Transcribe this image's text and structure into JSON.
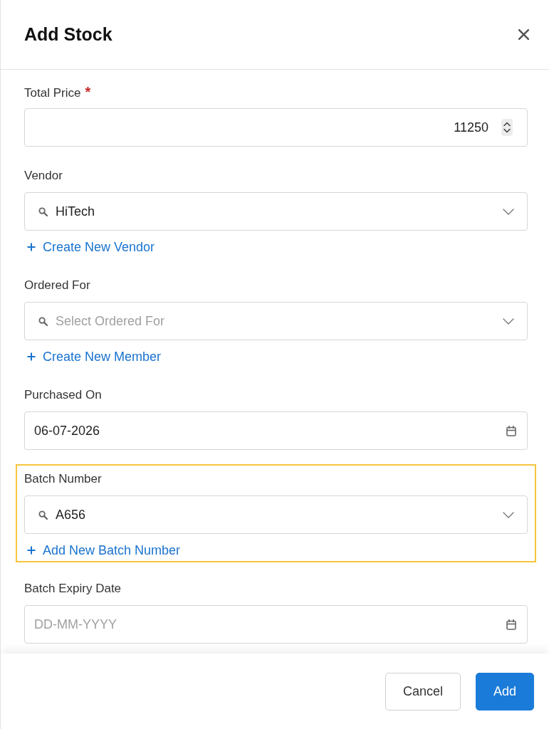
{
  "dialog": {
    "title": "Add Stock"
  },
  "fields": [
    {
      "kind": "number",
      "label": "Total Price",
      "required_mark": "*",
      "value": "11250",
      "highlighted": false
    },
    {
      "kind": "search-select",
      "label": "Vendor",
      "value": "HiTech",
      "link": "Create New Vendor",
      "highlighted": false
    },
    {
      "kind": "search-select",
      "label": "Ordered For",
      "placeholder": "Select Ordered For",
      "link": "Create New Member",
      "highlighted": false
    },
    {
      "kind": "date",
      "label": "Purchased On",
      "value": "06-07-2026",
      "highlighted": false
    },
    {
      "kind": "search-select",
      "label": "Batch Number",
      "value": "A656",
      "link": "Add New Batch Number",
      "highlighted": true
    },
    {
      "kind": "date",
      "label": "Batch Expiry Date",
      "placeholder": "DD-MM-YYYY",
      "highlighted": false
    }
  ],
  "buttons": [
    {
      "label": "Cancel",
      "kind": "secondary"
    },
    {
      "label": "Add",
      "kind": "primary"
    }
  ]
}
